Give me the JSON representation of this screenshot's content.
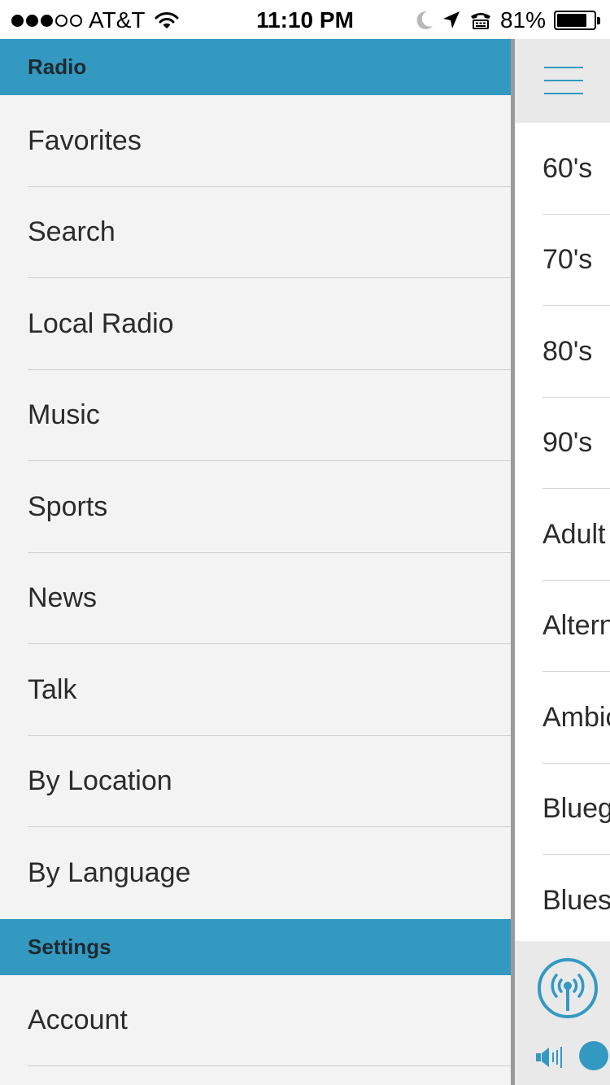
{
  "status_bar": {
    "signal_bars_filled": 3,
    "signal_bars_total": 5,
    "carrier": "AT&T",
    "time": "11:10 PM",
    "battery_percent_label": "81%",
    "battery_level": 0.81,
    "icons": [
      "wifi-icon",
      "moon-icon",
      "location-arrow-icon",
      "tty-icon",
      "battery-icon"
    ]
  },
  "drawer": {
    "sections": [
      {
        "header": "Radio",
        "items": [
          "Favorites",
          "Search",
          "Local Radio",
          "Music",
          "Sports",
          "News",
          "Talk",
          "By Location",
          "By Language"
        ]
      },
      {
        "header": "Settings",
        "items": [
          "Account"
        ]
      }
    ]
  },
  "main": {
    "menu_icon": "hamburger-icon",
    "genres": [
      "60's",
      "70's",
      "80's",
      "90's",
      "Adult",
      "Altern",
      "Ambic",
      "Blueg",
      "Blues"
    ]
  },
  "player": {
    "station_icon": "radio-tower-icon",
    "volume_icon": "speaker-icon"
  },
  "colors": {
    "accent": "#3399c1",
    "drawer_background": "#f3f3f3",
    "header_text": "#1e2a30"
  }
}
